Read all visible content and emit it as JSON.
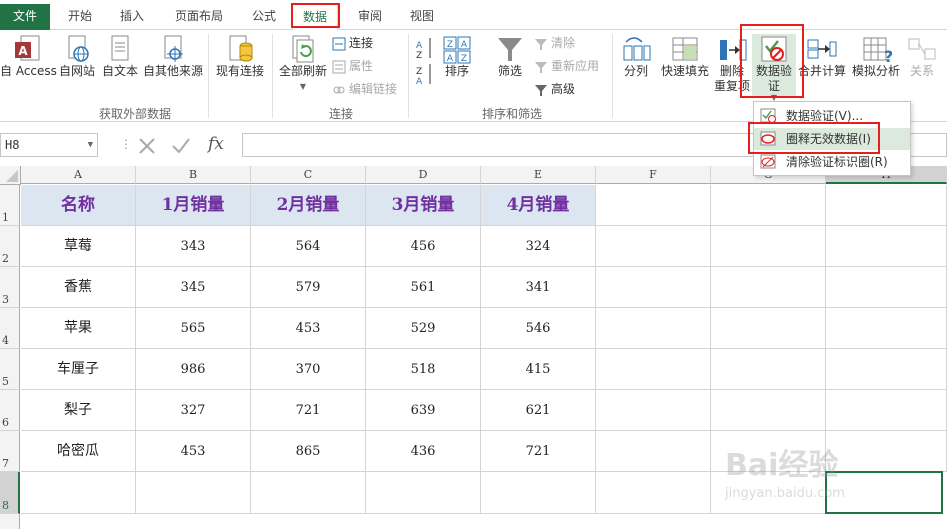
{
  "tabs": [
    "文件",
    "开始",
    "插入",
    "页面布局",
    "公式",
    "数据",
    "审阅",
    "视图"
  ],
  "ribbon": {
    "external_group": {
      "label": "获取外部数据",
      "items": [
        "自 Access",
        "自网站",
        "自文本",
        "自其他来源",
        "现有连接"
      ]
    },
    "connections_group": {
      "label": "连接",
      "refresh_label": "全部刷新",
      "items": [
        "连接",
        "属性",
        "编辑链接"
      ]
    },
    "sort_group": {
      "label": "排序和筛选",
      "sort_label": "排序",
      "filter_label": "筛选",
      "items": [
        "清除",
        "重新应用",
        "高级"
      ]
    },
    "tools": {
      "split_label": "分列",
      "flash_fill_label": "快速填充",
      "remove_dup_label_1": "删除",
      "remove_dup_label_2": "重复项",
      "validation_label_1": "数据验",
      "validation_label_2": "证",
      "consolidate_label": "合并计算",
      "whatif_label": "模拟分析",
      "relations_label": "关系"
    }
  },
  "formula_bar": {
    "name_box": "H8",
    "fx": "fx",
    "value": ""
  },
  "dropdown": {
    "items": [
      "数据验证(V)...",
      "圈释无效数据(I)",
      "清除验证标识圈(R)"
    ]
  },
  "sheet": {
    "columns": [
      "A",
      "B",
      "C",
      "D",
      "E",
      "F",
      "G",
      "H"
    ],
    "rows": [
      "1",
      "2",
      "3",
      "4",
      "5",
      "6",
      "7",
      "8"
    ],
    "header": [
      "名称",
      "1月销量",
      "2月销量",
      "3月销量",
      "4月销量"
    ],
    "data": [
      [
        "草莓",
        "343",
        "564",
        "456",
        "324"
      ],
      [
        "香蕉",
        "345",
        "579",
        "561",
        "341"
      ],
      [
        "苹果",
        "565",
        "453",
        "529",
        "546"
      ],
      [
        "车厘子",
        "986",
        "370",
        "518",
        "415"
      ],
      [
        "梨子",
        "327",
        "721",
        "639",
        "621"
      ],
      [
        "哈密瓜",
        "453",
        "865",
        "436",
        "721"
      ]
    ]
  },
  "watermark": {
    "brand": "Bai经验",
    "url": "jingyan.baidu.com"
  },
  "colors": {
    "excel_green": "#217346",
    "header_fill": "#dce6f1",
    "header_text": "#7030a0",
    "highlight_box": "#e51e1e"
  }
}
